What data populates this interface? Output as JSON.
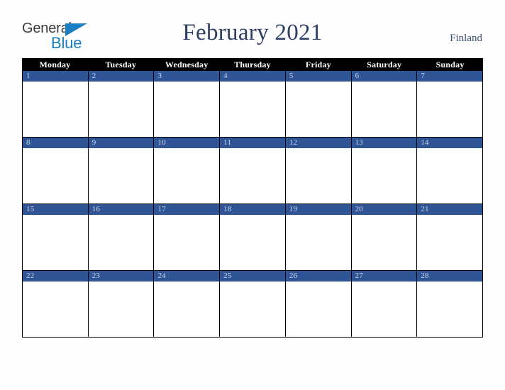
{
  "brand": {
    "name_top": "General",
    "name_bottom": "Blue",
    "triangle_icon": "triangle-icon",
    "color_top": "#3b3b3b",
    "color_bottom": "#1a7fc1"
  },
  "header": {
    "title": "February 2021",
    "country": "Finland",
    "title_color": "#2d3f63",
    "country_color": "#3e5278"
  },
  "calendar": {
    "month": "February",
    "year": "2021",
    "weekday_headers": [
      "Monday",
      "Tuesday",
      "Wednesday",
      "Thursday",
      "Friday",
      "Saturday",
      "Sunday"
    ],
    "header_bg": "#000000",
    "header_text_color": "#ffffff",
    "date_band_color": "#2f5597",
    "date_text_color": "#ccd4e6",
    "cell_bg": "#ffffff",
    "grid_line_color": "#000000",
    "weeks": [
      {
        "days": [
          {
            "number": "1",
            "events": ""
          },
          {
            "number": "2",
            "events": ""
          },
          {
            "number": "3",
            "events": ""
          },
          {
            "number": "4",
            "events": ""
          },
          {
            "number": "5",
            "events": ""
          },
          {
            "number": "6",
            "events": ""
          },
          {
            "number": "7",
            "events": ""
          }
        ]
      },
      {
        "days": [
          {
            "number": "8",
            "events": ""
          },
          {
            "number": "9",
            "events": ""
          },
          {
            "number": "10",
            "events": ""
          },
          {
            "number": "11",
            "events": ""
          },
          {
            "number": "12",
            "events": ""
          },
          {
            "number": "13",
            "events": ""
          },
          {
            "number": "14",
            "events": ""
          }
        ]
      },
      {
        "days": [
          {
            "number": "15",
            "events": ""
          },
          {
            "number": "16",
            "events": ""
          },
          {
            "number": "17",
            "events": ""
          },
          {
            "number": "18",
            "events": ""
          },
          {
            "number": "19",
            "events": ""
          },
          {
            "number": "20",
            "events": ""
          },
          {
            "number": "21",
            "events": ""
          }
        ]
      },
      {
        "days": [
          {
            "number": "22",
            "events": ""
          },
          {
            "number": "23",
            "events": ""
          },
          {
            "number": "24",
            "events": ""
          },
          {
            "number": "25",
            "events": ""
          },
          {
            "number": "26",
            "events": ""
          },
          {
            "number": "27",
            "events": ""
          },
          {
            "number": "28",
            "events": ""
          }
        ]
      }
    ]
  }
}
